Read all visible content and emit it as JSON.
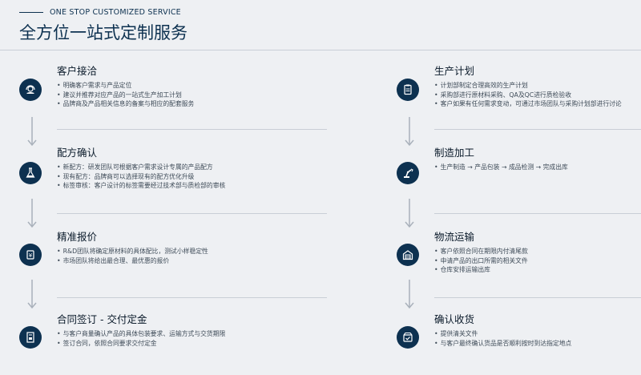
{
  "header": {
    "eyebrow": "ONE STOP CUSTOMIZED SERVICE",
    "title": "全方位一站式定制服务"
  },
  "left_steps": [
    {
      "title": "客户接洽",
      "icon": "headset-icon",
      "bullets": [
        "明确客户需求与产品定位",
        "建议并推荐对应产品的一站式生产加工计划",
        "品牌商及产品相关信息的备案与相应的配套服务"
      ]
    },
    {
      "title": "配方确认",
      "icon": "flask-icon",
      "bullets": [
        "新配方：研发团队可根据客户需求设计专属的产品配方",
        "现有配方：品牌商可以选择现有的配方优化升级",
        "标签审核：客户设计的标签需要经过技术部与质检部的审核"
      ]
    },
    {
      "title": "精准报价",
      "icon": "price-tag-icon",
      "bullets": [
        "R&D团队将确定原材料的具体配比，测试小样稳定性",
        "市场团队将给出最合理、最优惠的报价"
      ]
    },
    {
      "title": "合同签订 - 交付定金",
      "icon": "contract-icon",
      "bullets": [
        "与客户商量确认产品的具体包装要求、运输方式与交货期限",
        "签订合同，依照合同要求交付定金"
      ]
    }
  ],
  "right_steps": [
    {
      "title": "生产计划",
      "icon": "clipboard-icon",
      "bullets": [
        "计划部制定合理高效的生产计划",
        "采购部进行原材料采购、QA及QC进行质检验收",
        "客户如果有任何需求变动，可通过市场团队与采购计划部进行讨论"
      ]
    },
    {
      "title": "制造加工",
      "icon": "robot-arm-icon",
      "bullets": [
        "生产制造 → 产品包装 → 成品检测 → 完成出库"
      ]
    },
    {
      "title": "物流运输",
      "icon": "warehouse-icon",
      "bullets": [
        "客户依照合同在期限内付清尾款",
        "申请产品的出口所需的相关文件",
        "仓库安排运输出库"
      ]
    },
    {
      "title": "确认收货",
      "icon": "delivery-box-icon",
      "bullets": [
        "提供清关文件",
        "与客户最终确认货品是否顺利按时到达指定地点"
      ]
    }
  ],
  "colors": {
    "accent": "#0d3150",
    "arrow": "#a9b1bb",
    "background": "#eef0f3"
  }
}
